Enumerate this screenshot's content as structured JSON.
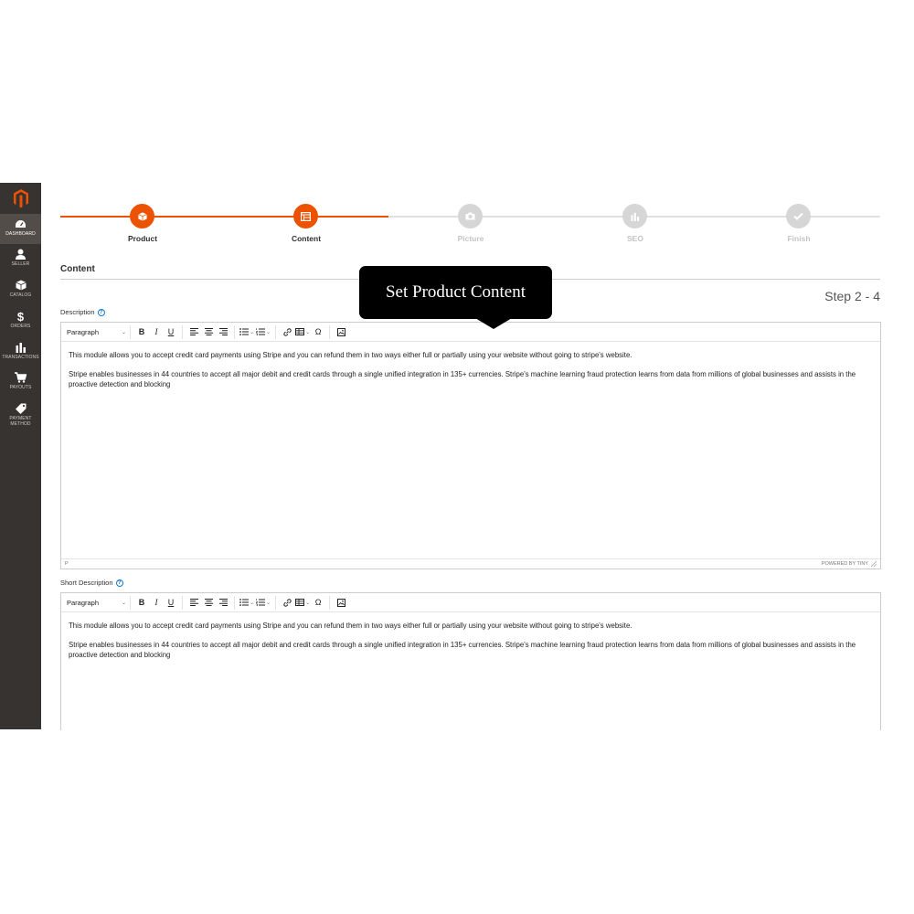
{
  "colors": {
    "accent": "#eb5202",
    "inactive": "#d6d6d6",
    "sidebar": "#373330"
  },
  "sidebar": {
    "logo": "magento-logo-icon",
    "items": [
      {
        "label": "DASHBOARD",
        "icon": "dashboard-icon",
        "active": true
      },
      {
        "label": "SELLER",
        "icon": "seller-icon"
      },
      {
        "label": "CATALOG",
        "icon": "catalog-icon"
      },
      {
        "label": "ORDERS",
        "icon": "dollar-icon"
      },
      {
        "label": "TRANSACTIONS",
        "icon": "bar-chart-icon"
      },
      {
        "label": "PAYOUTS",
        "icon": "cart-icon"
      },
      {
        "label": "PAYMENT METHOD",
        "icon": "tag-icon"
      }
    ]
  },
  "stepper": {
    "steps": [
      {
        "label": "Product",
        "icon": "box-icon",
        "state": "complete"
      },
      {
        "label": "Content",
        "icon": "content-icon",
        "state": "active"
      },
      {
        "label": "Picture",
        "icon": "camera-icon",
        "state": "pending"
      },
      {
        "label": "SEO",
        "icon": "chart-icon",
        "state": "pending"
      },
      {
        "label": "Finish",
        "icon": "check-icon",
        "state": "pending"
      }
    ]
  },
  "section": {
    "title": "Content",
    "step_indicator": "Step 2 - 4"
  },
  "tooltip": {
    "text": "Set Product Content"
  },
  "description": {
    "label": "Description",
    "format": "Paragraph",
    "paragraphs": [
      "This module allows you to accept credit card payments using Stripe and you can refund them in two ways either full or partially using your website without going to stripe's website.",
      "Stripe enables businesses in 44 countries to accept all major debit and credit cards through a single unified integration in 135+ currencies. Stripe's machine learning fraud protection learns from data from millions of global businesses and assists in the proactive detection and blocking"
    ],
    "status_path": "P",
    "powered_by": "POWERED BY TINY"
  },
  "short_description": {
    "label": "Short Description",
    "format": "Paragraph",
    "paragraphs": [
      "This module allows you to accept credit card payments using Stripe and you can refund them in two ways either full or partially using your website without going to stripe's website.",
      "Stripe enables businesses in 44 countries to accept all major debit and credit cards through a single unified integration in 135+ currencies. Stripe's machine learning fraud protection learns from data from millions of global businesses and assists in the proactive detection and blocking"
    ]
  },
  "toolbar": {
    "bold": "B",
    "italic": "I",
    "underline": "U",
    "special_char": "Ω"
  }
}
